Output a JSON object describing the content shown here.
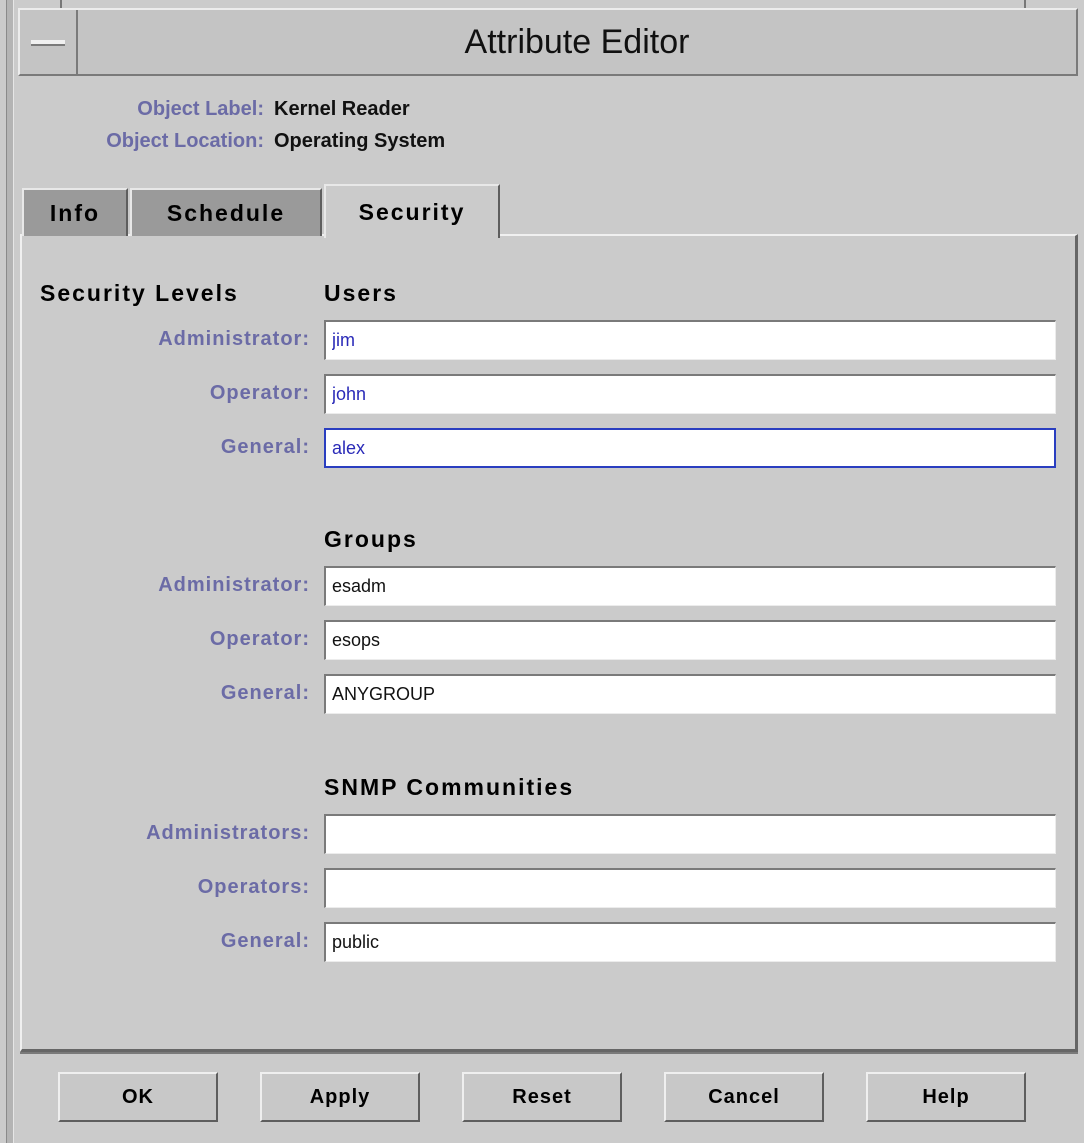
{
  "window": {
    "title": "Attribute Editor"
  },
  "object": {
    "label_key": "Object Label:",
    "label_value": "Kernel Reader",
    "location_key": "Object Location:",
    "location_value": "Operating System"
  },
  "tabs": [
    {
      "label": "Info",
      "active": false
    },
    {
      "label": "Schedule",
      "active": false
    },
    {
      "label": "Security",
      "active": true
    }
  ],
  "security": {
    "levels_heading": "Security Levels",
    "users": {
      "heading": "Users",
      "fields": [
        {
          "label": "Administrator:",
          "value": "jim"
        },
        {
          "label": "Operator:",
          "value": "john"
        },
        {
          "label": "General:",
          "value": "alex"
        }
      ]
    },
    "groups": {
      "heading": "Groups",
      "fields": [
        {
          "label": "Administrator:",
          "value": "esadm"
        },
        {
          "label": "Operator:",
          "value": "esops"
        },
        {
          "label": "General:",
          "value": "ANYGROUP"
        }
      ]
    },
    "snmp": {
      "heading": "SNMP Communities",
      "fields": [
        {
          "label": "Administrators:",
          "value": ""
        },
        {
          "label": "Operators:",
          "value": ""
        },
        {
          "label": "General:",
          "value": "public"
        }
      ]
    }
  },
  "buttons": {
    "ok": "OK",
    "apply": "Apply",
    "reset": "Reset",
    "cancel": "Cancel",
    "help": "Help"
  },
  "colors": {
    "label_color": "#6b6ba6",
    "user_value_color": "#2a2ab8",
    "focus_border": "#2a3ec0",
    "background": "#cbcbcb"
  }
}
